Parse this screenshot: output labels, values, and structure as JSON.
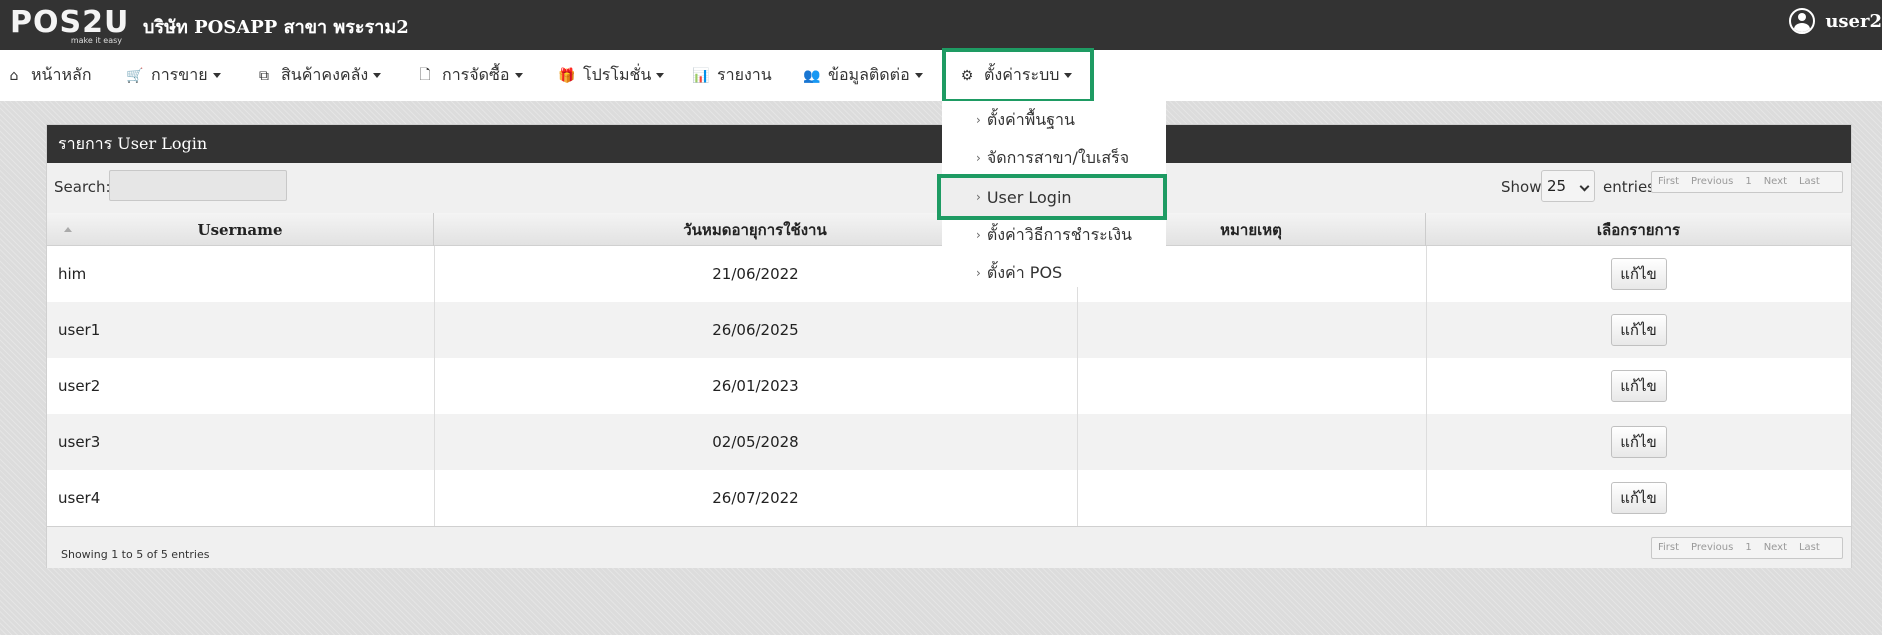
{
  "brand": {
    "logo_text": "POS2U",
    "logo_tagline": "make it easy",
    "company": "บริษัท POSAPP สาขา พระราม2"
  },
  "user": {
    "name": "user2",
    "icon": "user-circle-icon"
  },
  "nav": {
    "items": [
      {
        "label": "หน้าหลัก",
        "icon": "home-icon",
        "glyph": "⌂"
      },
      {
        "label": "การขาย",
        "icon": "cart-icon",
        "glyph": "🛒"
      },
      {
        "label": "สินค้าคงคลัง",
        "icon": "cubes-icon",
        "glyph": "⧉"
      },
      {
        "label": "การจัดซื้อ",
        "icon": "document-icon",
        "glyph": "🗋"
      },
      {
        "label": "โปรโมชั่น",
        "icon": "gift-icon",
        "glyph": "🎁"
      },
      {
        "label": "รายงาน",
        "icon": "bar-chart-icon",
        "glyph": "📊"
      },
      {
        "label": "ข้อมูลติดต่อ",
        "icon": "users-icon",
        "glyph": "👥"
      },
      {
        "label": "ตั้งค่าระบบ",
        "icon": "gear-icon",
        "glyph": "⚙"
      }
    ]
  },
  "dropdown": {
    "items": [
      {
        "label": "ตั้งค่าพื้นฐาน"
      },
      {
        "label": "จัดการสาขา/ใบเสร็จ"
      },
      {
        "label": "User Login"
      },
      {
        "label": "ตั้งค่าวิธีการชำระเงิน"
      },
      {
        "label": "ตั้งค่า POS"
      }
    ]
  },
  "panel": {
    "title": "รายการ User Login",
    "search_label": "Search:",
    "search_value": "",
    "show_label": "Show",
    "page_size": "25",
    "entries_label": "entries",
    "pager": {
      "first": "First",
      "previous": "Previous",
      "page": "1",
      "next": "Next",
      "last": "Last"
    },
    "columns": [
      "Username",
      "วันหมดอายุการใช้งาน",
      "หมายเหตุ",
      "เลือกรายการ"
    ],
    "rows": [
      {
        "username": "him",
        "expiry": "21/06/2022",
        "note": "",
        "action": "แก้ไข"
      },
      {
        "username": "user1",
        "expiry": "26/06/2025",
        "note": "",
        "action": "แก้ไข"
      },
      {
        "username": "user2",
        "expiry": "26/01/2023",
        "note": "",
        "action": "แก้ไข"
      },
      {
        "username": "user3",
        "expiry": "02/05/2028",
        "note": "",
        "action": "แก้ไข"
      },
      {
        "username": "user4",
        "expiry": "26/07/2022",
        "note": "",
        "action": "แก้ไข"
      }
    ],
    "footer_info": "Showing 1 to 5 of 5 entries"
  },
  "colors": {
    "topbar": "#333333",
    "highlight": "#1e9b63",
    "background": "#dcdcdc"
  }
}
